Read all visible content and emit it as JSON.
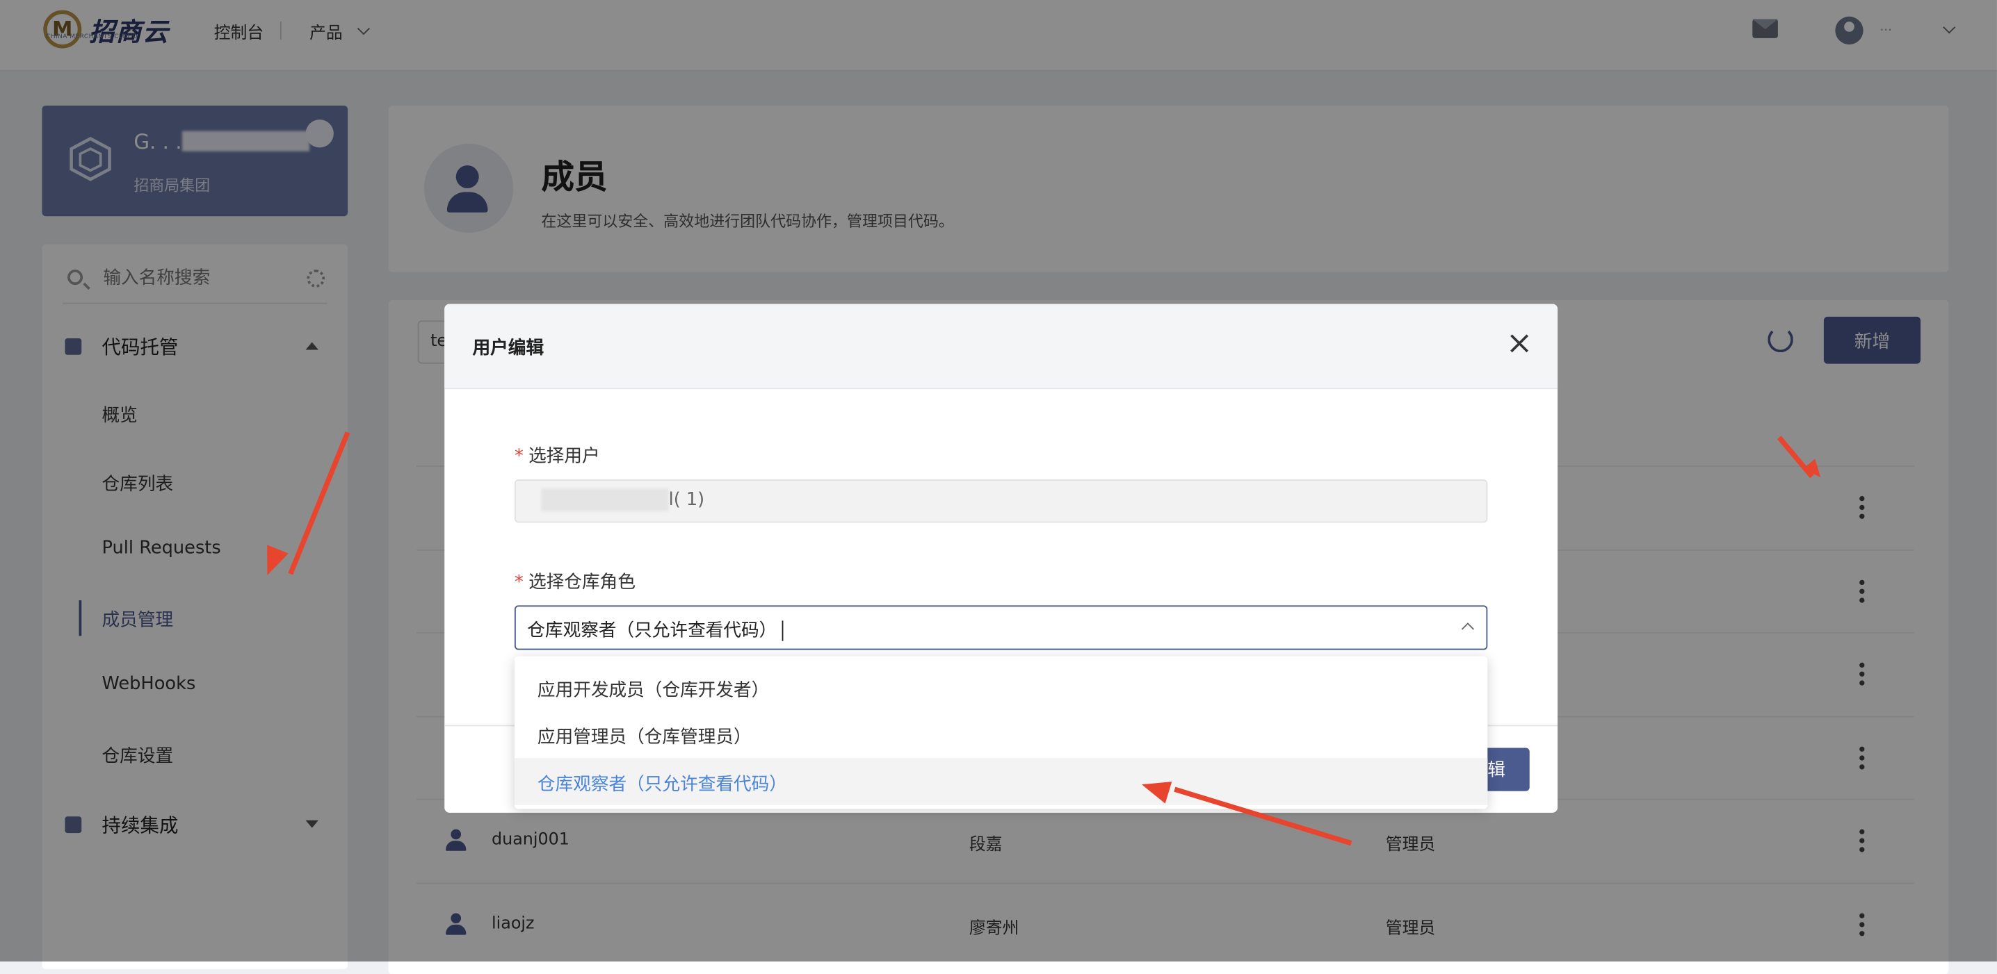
{
  "topbar": {
    "brand": "招商云",
    "brand_sub": "CHINA MERCHANTS CLOUD",
    "nav_console": "控制台",
    "nav_products": "产品",
    "user_name": "..."
  },
  "project": {
    "name": "G.  .  .",
    "org": "招商局集团"
  },
  "sidebar": {
    "search_placeholder": "输入名称搜索",
    "group_code": "代码托管",
    "items": [
      {
        "label": "概览"
      },
      {
        "label": "仓库列表"
      },
      {
        "label": "Pull Requests"
      },
      {
        "label": "成员管理"
      },
      {
        "label": "WebHooks"
      },
      {
        "label": "仓库设置"
      }
    ],
    "group_ci": "持续集成"
  },
  "header": {
    "title": "成员",
    "description": "在这里可以安全、高效地进行团队代码协作，管理项目代码。"
  },
  "list": {
    "filter_value": "te",
    "add_label": "新增",
    "rows": [
      {
        "username": "duanj001",
        "display": "段嘉",
        "role": "管理员"
      },
      {
        "username": "liaojz",
        "display": "廖寄州",
        "role": "管理员"
      }
    ]
  },
  "modal": {
    "title": "用户编辑",
    "user_label": "选择用户",
    "user_value": "l(  1)",
    "role_label": "选择仓库角色",
    "role_value": "仓库观察者（只允许查看代码）",
    "ok_label": "辑",
    "options": [
      {
        "label": "应用开发成员（仓库开发者）"
      },
      {
        "label": "应用管理员（仓库管理员）"
      },
      {
        "label": "仓库观察者（只允许查看代码）"
      }
    ]
  },
  "colors": {
    "primary": "#4b5a8f",
    "selected_option_text": "#4b84d6",
    "annotation_arrow": "#e8452f",
    "required_star": "#e0443a"
  }
}
